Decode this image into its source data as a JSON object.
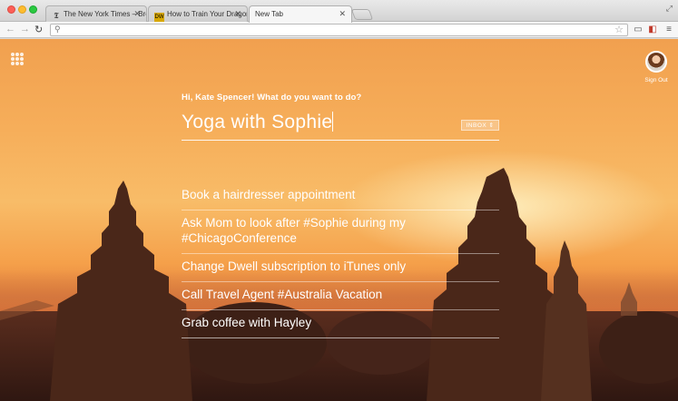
{
  "browser": {
    "tabs": [
      {
        "label": "The New York Times – Bre",
        "favicon": "nyt-favicon"
      },
      {
        "label": "How to Train Your Dragon",
        "favicon": "dreamworks-favicon"
      },
      {
        "label": "New Tab",
        "favicon": "none"
      }
    ],
    "address": ""
  },
  "page": {
    "greeting": "Hi, Kate Spencer! What do you want to do?",
    "input_value": "Yoga with Sophie",
    "inbox_label": "INBOX ⇕",
    "signout_label": "Sign Out",
    "todos": [
      "Book a hairdresser appointment",
      "Ask Mom to look after #Sophie during my #ChicagoConference",
      "Change Dwell subscription to iTunes only",
      "Call Travel Agent #Australia Vacation",
      "Grab coffee with Hayley"
    ]
  }
}
